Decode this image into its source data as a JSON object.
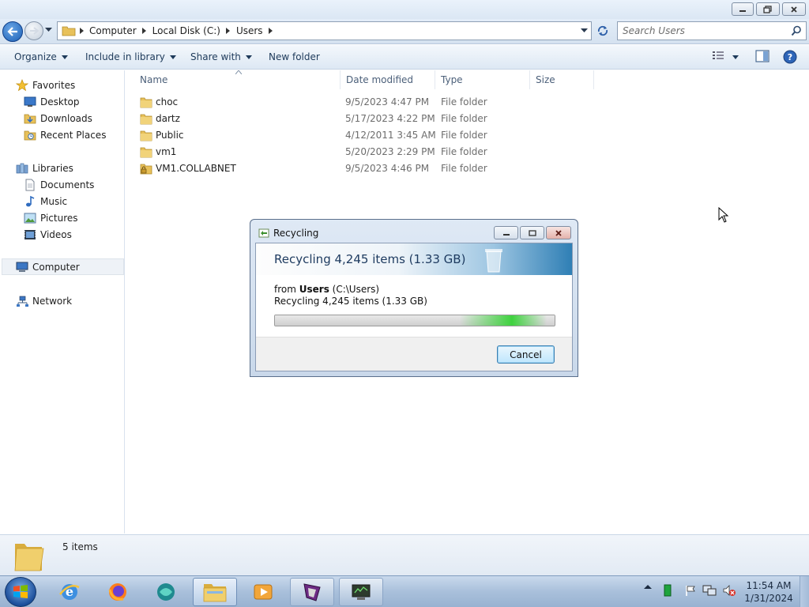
{
  "window": {
    "controls": {
      "minimize": "minimize-icon",
      "restore": "restore-icon",
      "close": "close-icon"
    }
  },
  "navbar": {
    "breadcrumbs": [
      "Computer",
      "Local Disk (C:)",
      "Users"
    ],
    "search_placeholder": "Search Users"
  },
  "toolbar": {
    "organize": "Organize",
    "include_in_library": "Include in library",
    "share_with": "Share with",
    "new_folder": "New folder"
  },
  "navpane": {
    "favorites": "Favorites",
    "desktop": "Desktop",
    "downloads": "Downloads",
    "recent_places": "Recent Places",
    "libraries": "Libraries",
    "documents": "Documents",
    "music": "Music",
    "pictures": "Pictures",
    "videos": "Videos",
    "computer": "Computer",
    "network": "Network"
  },
  "filelist": {
    "columns": {
      "name": "Name",
      "date": "Date modified",
      "type": "Type",
      "size": "Size"
    },
    "rows": [
      {
        "name": "choc",
        "date": "9/5/2023 4:47 PM",
        "type": "File folder",
        "locked": false
      },
      {
        "name": "dartz",
        "date": "5/17/2023 4:22 PM",
        "type": "File folder",
        "locked": false
      },
      {
        "name": "Public",
        "date": "4/12/2011 3:45 AM",
        "type": "File folder",
        "locked": false
      },
      {
        "name": "vm1",
        "date": "5/20/2023 2:29 PM",
        "type": "File folder",
        "locked": false
      },
      {
        "name": "VM1.COLLABNET",
        "date": "9/5/2023 4:46 PM",
        "type": "File folder",
        "locked": true
      }
    ]
  },
  "details": {
    "count": "5 items"
  },
  "dialog": {
    "title": "Recycling",
    "heading": "Recycling 4,245 items (1.33 GB)",
    "from_prefix": "from ",
    "from_name": "Users",
    "from_path": " (C:\\Users)",
    "subtext": "Recycling 4,245 items (1.33 GB)",
    "cancel": "Cancel"
  },
  "taskbar": {
    "clock_time": "11:54 AM",
    "clock_date": "1/31/2024"
  },
  "colors": {
    "accent": "#1c4e9a",
    "progress": "#3fd23f"
  }
}
